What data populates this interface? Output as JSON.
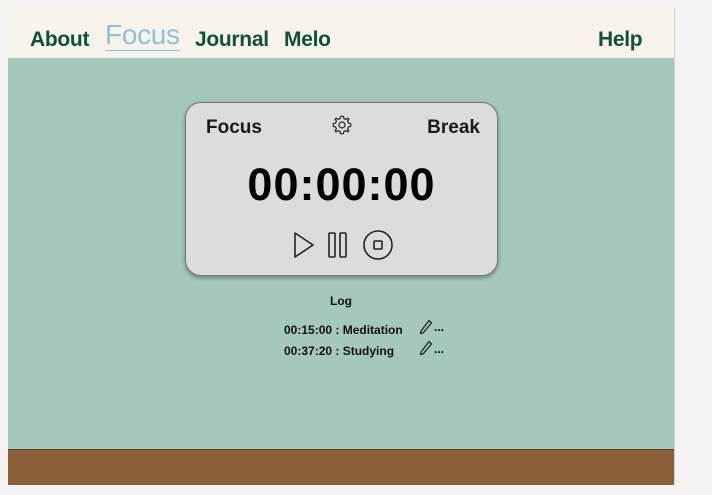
{
  "nav": {
    "about": "About",
    "focus": "Focus",
    "journal": "Journal",
    "melo": "Melo",
    "help": "Help"
  },
  "timer": {
    "mode_focus": "Focus",
    "mode_break": "Break",
    "time": "00:00:00",
    "icons": [
      "gear-icon",
      "play-icon",
      "pause-icon",
      "stop-icon"
    ]
  },
  "log": {
    "title": "Log",
    "entries": [
      {
        "text": "00:15:00 : Meditation",
        "more": "..."
      },
      {
        "text": "00:37:20 : Studying",
        "more": "..."
      }
    ]
  },
  "colors": {
    "background": "#a4c8b9",
    "navbar": "#f7f3ea",
    "nav_text": "#0f5136",
    "active_nav": "#8ec0d9",
    "card": "#dcdcdc",
    "footer": "#8b6038"
  }
}
